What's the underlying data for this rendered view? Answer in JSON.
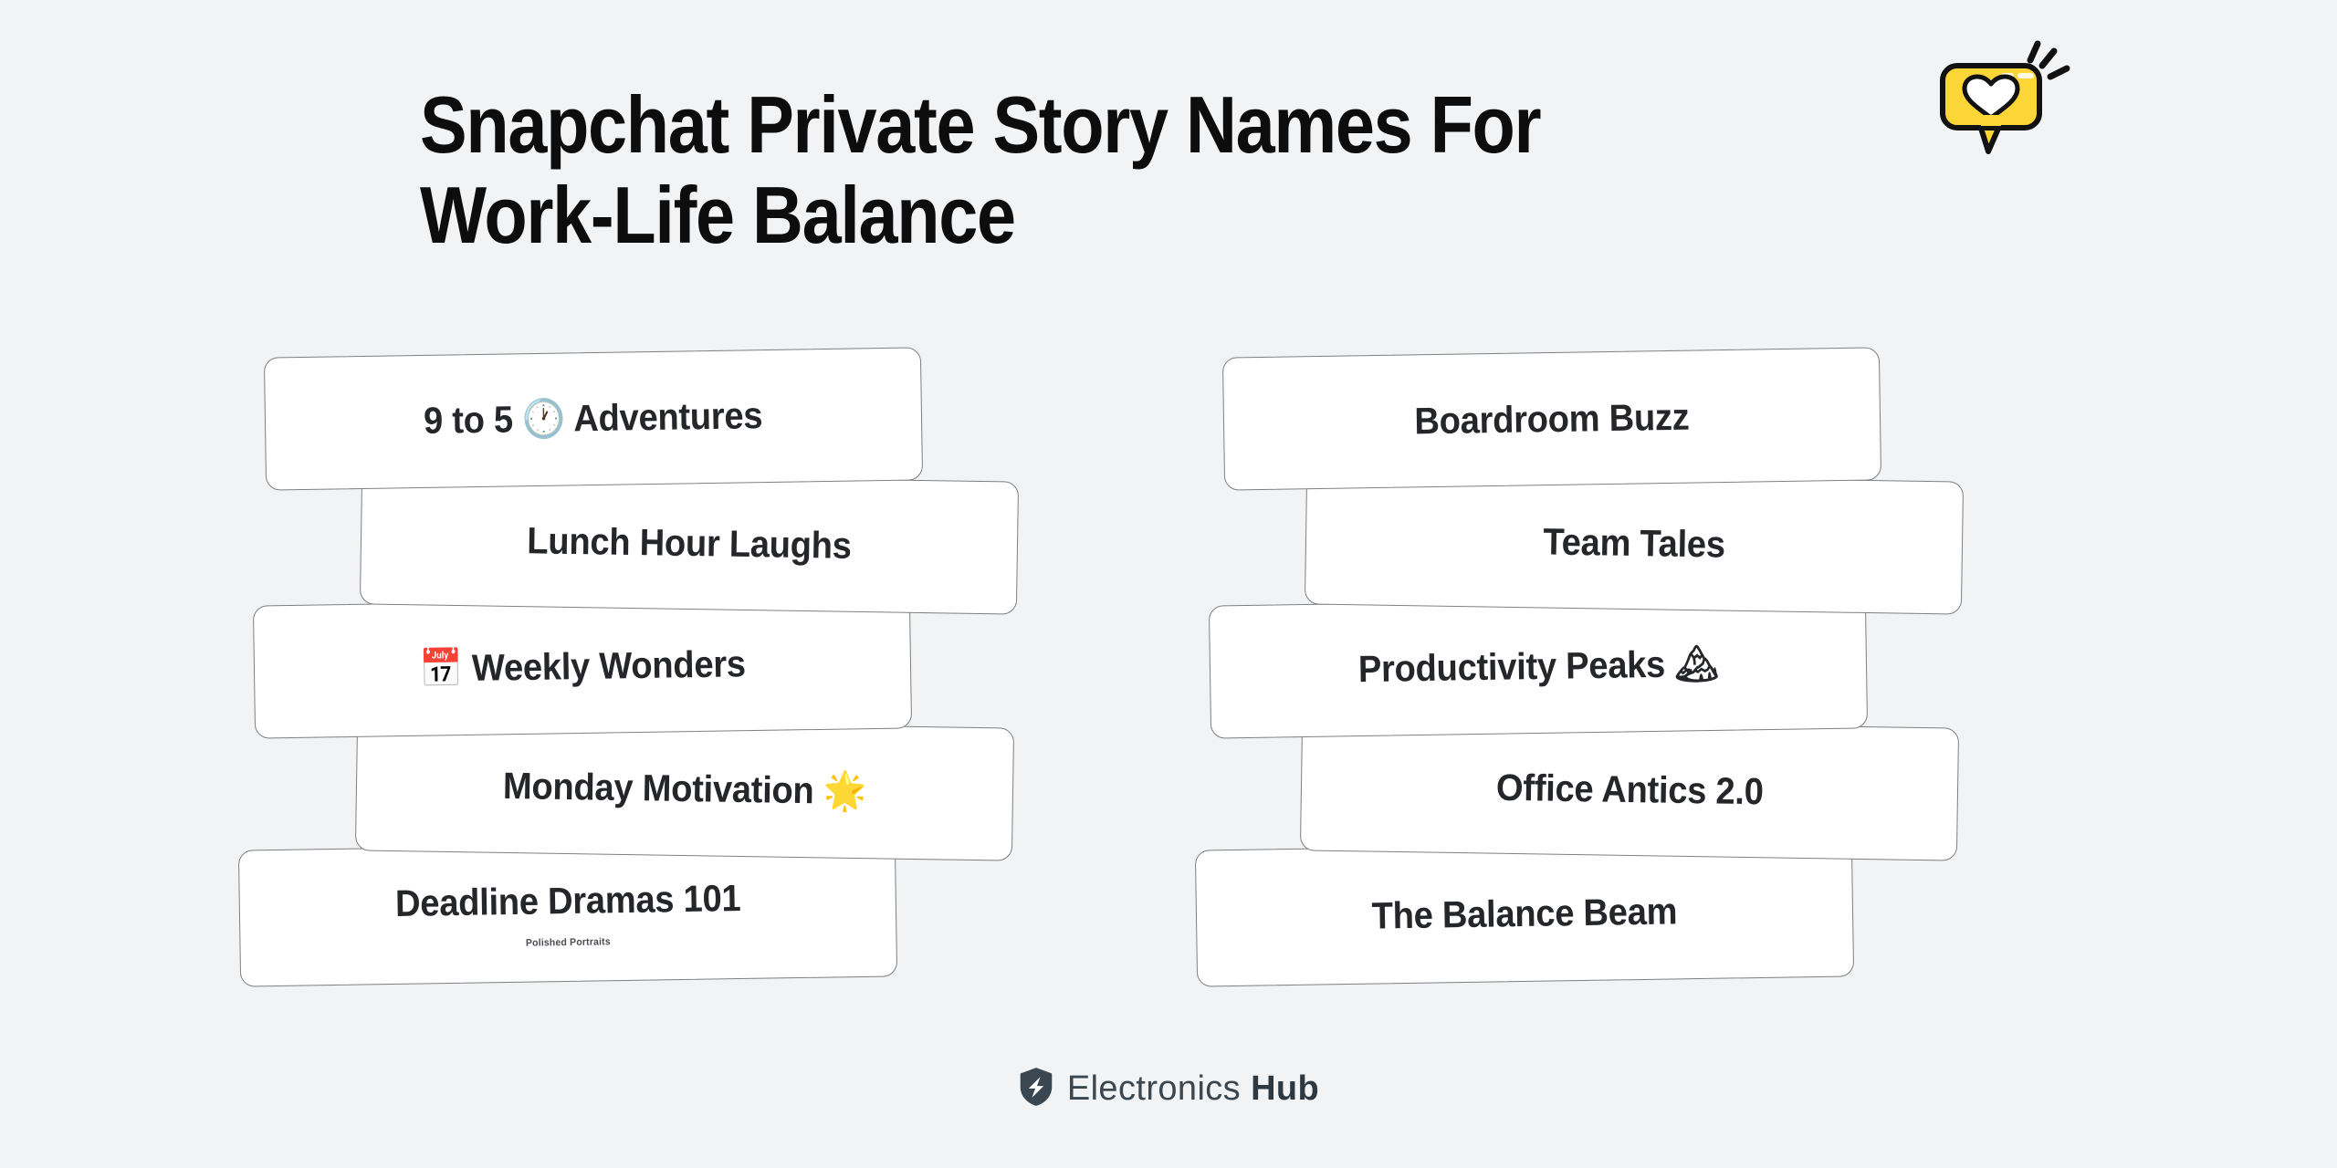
{
  "header": {
    "title": "Snapchat Private Story Names For\nWork-Life Balance",
    "badge_icon": "speech-bubble-heart-icon",
    "badge_color": "#fcd636"
  },
  "theme": {
    "background": "#f2f3f5",
    "card_background": "#ffffff",
    "card_border": "#7d7f82",
    "text_color": "#25262a",
    "brand_color": "#3b4750"
  },
  "columns": [
    {
      "side": "left",
      "cards": [
        {
          "text": "9 to 5 🕐 Adventures",
          "emoji": "clock-icon",
          "subtitle": ""
        },
        {
          "text": "Lunch Hour Laughs",
          "emoji": "",
          "subtitle": ""
        },
        {
          "text": "📅 Weekly Wonders",
          "emoji": "calendar-icon",
          "subtitle": ""
        },
        {
          "text": "Monday Motivation 🌟",
          "emoji": "glowing-star-icon",
          "subtitle": ""
        },
        {
          "text": "Deadline Dramas 101",
          "emoji": "",
          "subtitle": "Polished Portraits"
        }
      ]
    },
    {
      "side": "right",
      "cards": [
        {
          "text": "Boardroom Buzz",
          "emoji": "",
          "subtitle": ""
        },
        {
          "text": "Team Tales",
          "emoji": "",
          "subtitle": ""
        },
        {
          "text": "Productivity Peaks 🏔",
          "emoji": "mountain-icon",
          "subtitle": ""
        },
        {
          "text": "Office Antics 2.0",
          "emoji": "",
          "subtitle": ""
        },
        {
          "text": "The Balance Beam",
          "emoji": "",
          "subtitle": ""
        }
      ]
    }
  ],
  "footer": {
    "logo_icon": "shield-bolt-icon",
    "brand_first": "Electronics",
    "brand_second": "Hub"
  }
}
